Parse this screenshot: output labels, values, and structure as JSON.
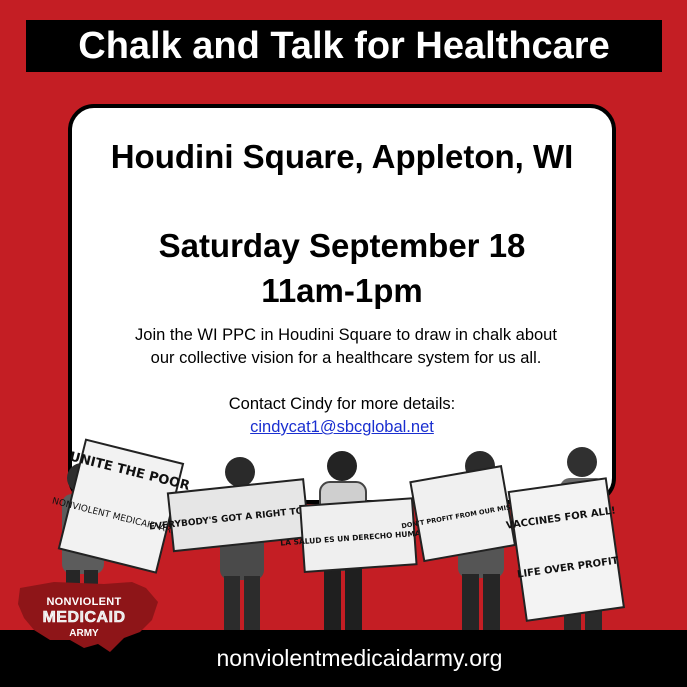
{
  "header": {
    "title": "Chalk and Talk for Healthcare"
  },
  "event": {
    "venue": "Houdini Square, Appleton, WI",
    "date": "Saturday September 18",
    "time": "11am-1pm",
    "description": "Join the WI PPC in Houdini Square to draw in chalk about our collective vision for a healthcare system for us all.",
    "contact": "Contact Cindy for more details:",
    "email": "cindycat1@sbcglobal.net"
  },
  "signs": [
    "UNITE THE POOR",
    "NONVIOLENT MEDICAID ARMY",
    "EVERYBODY'S GOT A RIGHT TO LIVE",
    "LA SALUD ES UN DERECHO HUMANO!",
    "DON'T PROFIT FROM OUR MISERY",
    "VACCINES FOR ALL!",
    "LIFE OVER PROFIT"
  ],
  "logo": {
    "line1": "NONVIOLENT",
    "line2": "MEDICAID",
    "line3": "ARMY"
  },
  "footer": {
    "url": "nonviolentmedicaidarmy.org"
  },
  "colors": {
    "background": "#c41e24",
    "bar": "#000000",
    "card": "#ffffff",
    "link": "#1a2fd0"
  }
}
